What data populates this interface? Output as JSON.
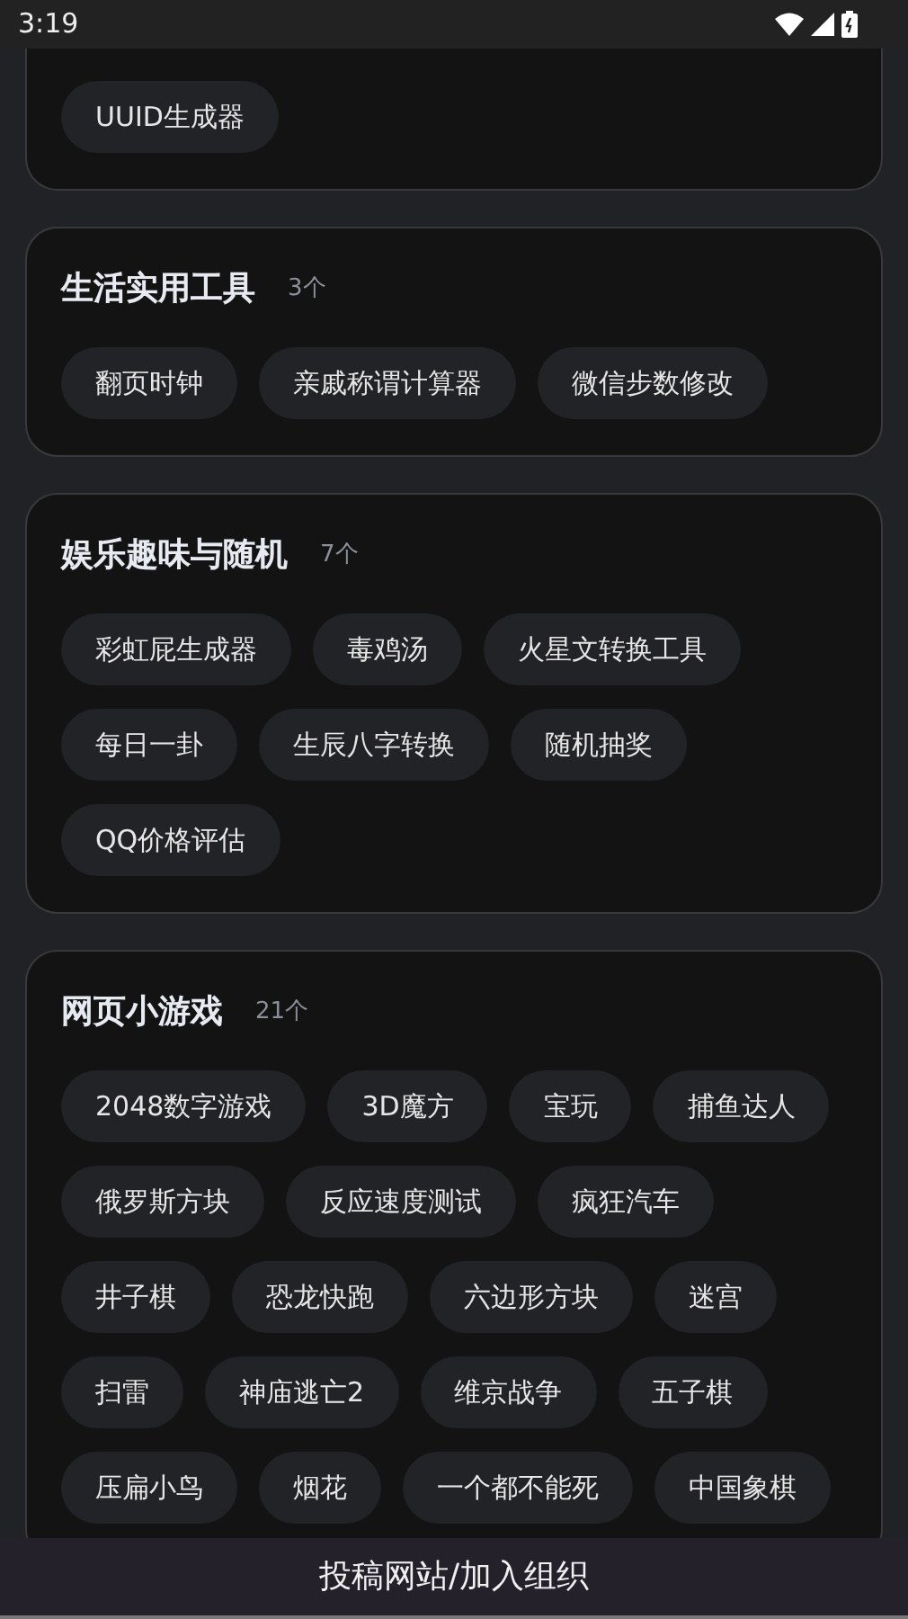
{
  "status_bar": {
    "time": "3:19"
  },
  "sections": [
    {
      "chips": [
        "UUID生成器"
      ]
    },
    {
      "title": "生活实用工具",
      "count": "3个",
      "chips": [
        "翻页时钟",
        "亲戚称谓计算器",
        "微信步数修改"
      ]
    },
    {
      "title": "娱乐趣味与随机",
      "count": "7个",
      "chips": [
        "彩虹屁生成器",
        "毒鸡汤",
        "火星文转换工具",
        "每日一卦",
        "生辰八字转换",
        "随机抽奖",
        "QQ价格评估"
      ]
    },
    {
      "title": "网页小游戏",
      "count": "21个",
      "chips": [
        "2048数字游戏",
        "3D魔方",
        "宝玩",
        "捕鱼达人",
        "俄罗斯方块",
        "反应速度测试",
        "疯狂汽车",
        "井子棋",
        "恐龙快跑",
        "六边形方块",
        "迷宫",
        "扫雷",
        "神庙逃亡2",
        "维京战争",
        "五子棋",
        "压扁小鸟",
        "烟花",
        "一个都不能死",
        "中国象棋"
      ]
    }
  ],
  "bottom_button": "投稿网站/加入组织"
}
